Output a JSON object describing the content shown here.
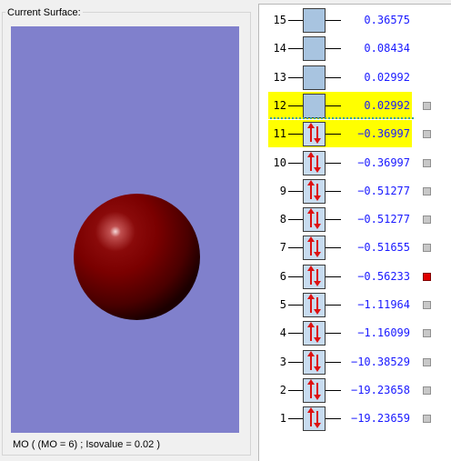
{
  "surface_group": {
    "title": "Current Surface:",
    "status": "MO ( (MO = 6) ; Isovalue = 0.02 )"
  },
  "colors": {
    "viewport_bg": "#8080cc",
    "sphere": "#7a0000",
    "highlight": "#ffff00",
    "energy_text": "#1a1aff",
    "active_checkbox": "#e00000"
  },
  "orbitals": [
    {
      "index": "15",
      "energy": "0.36575",
      "occupied": false,
      "highlighted": false,
      "selectable": false,
      "selected": false
    },
    {
      "index": "14",
      "energy": "0.08434",
      "occupied": false,
      "highlighted": false,
      "selectable": false,
      "selected": false
    },
    {
      "index": "13",
      "energy": "0.02992",
      "occupied": false,
      "highlighted": false,
      "selectable": false,
      "selected": false
    },
    {
      "index": "12",
      "energy": "0.02992",
      "occupied": false,
      "highlighted": true,
      "selectable": true,
      "selected": false
    },
    {
      "index": "11",
      "energy": "−0.36997",
      "occupied": true,
      "highlighted": true,
      "selectable": true,
      "selected": false
    },
    {
      "index": "10",
      "energy": "−0.36997",
      "occupied": true,
      "highlighted": false,
      "selectable": true,
      "selected": false
    },
    {
      "index": "9",
      "energy": "−0.51277",
      "occupied": true,
      "highlighted": false,
      "selectable": true,
      "selected": false
    },
    {
      "index": "8",
      "energy": "−0.51277",
      "occupied": true,
      "highlighted": false,
      "selectable": true,
      "selected": false
    },
    {
      "index": "7",
      "energy": "−0.51655",
      "occupied": true,
      "highlighted": false,
      "selectable": true,
      "selected": false
    },
    {
      "index": "6",
      "energy": "−0.56233",
      "occupied": true,
      "highlighted": false,
      "selectable": true,
      "selected": true
    },
    {
      "index": "5",
      "energy": "−1.11964",
      "occupied": true,
      "highlighted": false,
      "selectable": true,
      "selected": false
    },
    {
      "index": "4",
      "energy": "−1.16099",
      "occupied": true,
      "highlighted": false,
      "selectable": true,
      "selected": false
    },
    {
      "index": "3",
      "energy": "−10.38529",
      "occupied": true,
      "highlighted": false,
      "selectable": true,
      "selected": false
    },
    {
      "index": "2",
      "energy": "−19.23658",
      "occupied": true,
      "highlighted": false,
      "selectable": true,
      "selected": false
    },
    {
      "index": "1",
      "energy": "−19.23659",
      "occupied": true,
      "highlighted": false,
      "selectable": true,
      "selected": false
    }
  ]
}
